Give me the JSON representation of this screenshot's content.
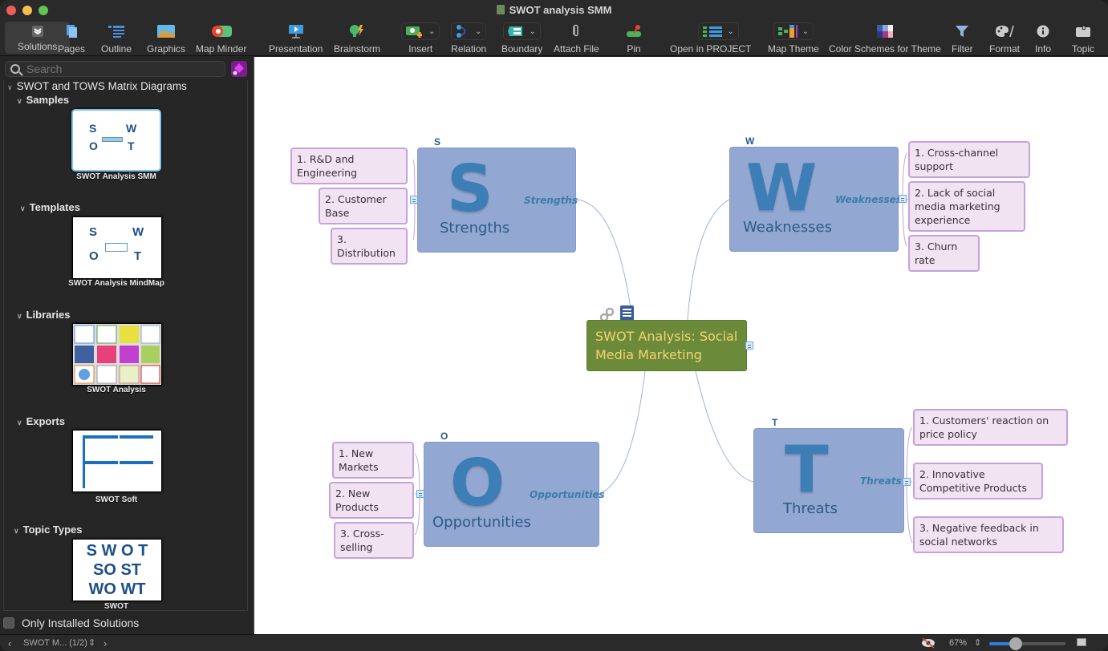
{
  "window": {
    "title": "SWOT analysis SMM",
    "traffic_lights": {
      "close": "#ec5f57",
      "minimize": "#f5bf4f",
      "zoom": "#5fc454"
    }
  },
  "toolbar": {
    "items": [
      {
        "id": "solutions",
        "label": "Solutions",
        "icon": "solutions-icon",
        "selected": true
      },
      {
        "id": "pages",
        "label": "Pages",
        "icon": "pages-icon"
      },
      {
        "id": "outline",
        "label": "Outline",
        "icon": "outline-icon"
      },
      {
        "id": "graphics",
        "label": "Graphics",
        "icon": "graphics-icon"
      },
      {
        "id": "map-minder",
        "label": "Map Minder",
        "icon": "map-minder-icon"
      },
      {
        "id": "presentation",
        "label": "Presentation",
        "icon": "presentation-icon"
      },
      {
        "id": "brainstorm",
        "label": "Brainstorm",
        "icon": "brainstorm-icon"
      },
      {
        "id": "insert",
        "label": "Insert",
        "icon": "insert-topic-icon",
        "dropdown": true
      },
      {
        "id": "relation",
        "label": "Relation",
        "icon": "relation-icon",
        "dropdown": true
      },
      {
        "id": "boundary",
        "label": "Boundary",
        "icon": "boundary-icon",
        "dropdown": true
      },
      {
        "id": "attach-file",
        "label": "Attach File",
        "icon": "paperclip-icon"
      },
      {
        "id": "pin",
        "label": "Pin",
        "icon": "pin-icon"
      },
      {
        "id": "open-in-project",
        "label": "Open in PROJECT",
        "icon": "project-icon",
        "dropdown": true
      },
      {
        "id": "map-theme",
        "label": "Map Theme",
        "icon": "map-theme-icon",
        "dropdown": true
      },
      {
        "id": "color-schemes",
        "label": "Color Schemes for Theme",
        "icon": "color-scheme-icon"
      },
      {
        "id": "filter",
        "label": "Filter",
        "icon": "filter-icon"
      },
      {
        "id": "format",
        "label": "Format",
        "icon": "palette-icon"
      },
      {
        "id": "info",
        "label": "Info",
        "icon": "info-icon"
      },
      {
        "id": "topic",
        "label": "Topic",
        "icon": "topic-icon"
      }
    ]
  },
  "sidebar": {
    "search_placeholder": "Search",
    "root": "SWOT and TOWS Matrix Diagrams",
    "sections": [
      {
        "title": "Samples",
        "item": "SWOT Analysis SMM",
        "selected": true
      },
      {
        "title": "Templates",
        "item": "SWOT Analysis MindMap"
      },
      {
        "title": "Libraries",
        "item": "SWOT Analysis"
      },
      {
        "title": "Exports",
        "item": "SWOT Soft"
      },
      {
        "title": "Topic Types",
        "item": "SWOT"
      }
    ],
    "topic_types_preview": [
      "S W O T",
      "SO  ST",
      "WO WT"
    ],
    "only_installed_label": "Only Installed Solutions",
    "only_installed_checked": false
  },
  "statusbar": {
    "page_label": "SWOT M... (1/2)",
    "zoom": "67%",
    "zoom_slider_fraction": 0.35
  },
  "mindmap": {
    "central_topic": "SWOT Analysis: Social Media Marketing",
    "colors": {
      "central_bg": "#6b8a3a",
      "central_text": "#f7d46e",
      "quadrant_bg": "#92a7d2",
      "subtopic_bg": "#f2e3f2",
      "subtopic_border": "#c6a1dc"
    },
    "quadrants": [
      {
        "id": "S",
        "letter": "S",
        "name": "Strengths",
        "tag": "Strengths",
        "items": [
          "1. R&D and Engineering",
          "2. Customer Base",
          "3. Distribution"
        ]
      },
      {
        "id": "W",
        "letter": "W",
        "name": "Weaknesses",
        "tag": "Weaknesses",
        "items": [
          "1. Cross-channel support",
          "2. Lack of social media marketing experience",
          "3. Churn rate"
        ]
      },
      {
        "id": "O",
        "letter": "O",
        "name": "Opportunities",
        "tag": "Opportunities",
        "items": [
          "1. New Markets",
          "2. New Products",
          "3. Cross-selling"
        ]
      },
      {
        "id": "T",
        "letter": "T",
        "name": "Threats",
        "tag": "Threats",
        "items": [
          "1. Customers' reaction on price policy",
          "2. Innovative Competitive Products",
          "3. Negative feedback in social networks"
        ]
      }
    ]
  }
}
